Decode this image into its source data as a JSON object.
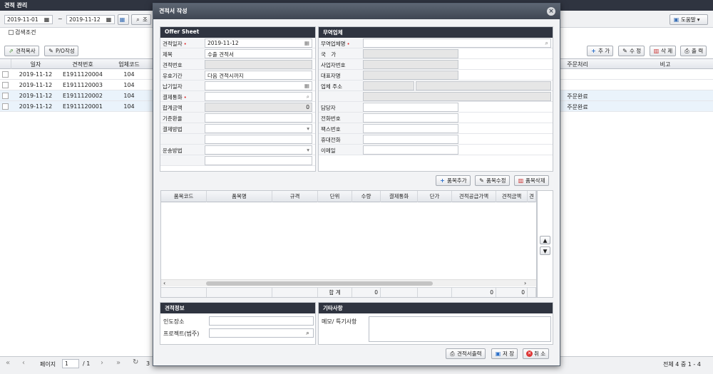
{
  "app": {
    "title": "견적 관리"
  },
  "filters": {
    "date_from": "2019-11-01",
    "date_sep": "~",
    "date_to": "2019-11-12",
    "query_label": "조",
    "search_cond": "검색조건",
    "help": "도움말"
  },
  "toolbar": {
    "copy": "견적복사",
    "po": "P/O작성",
    "add": "추 가",
    "edit": "수 정",
    "delete": "삭 제",
    "print": "출 력"
  },
  "grid": {
    "headers_left": [
      "일자",
      "견적번호",
      "업체코드"
    ],
    "headers_right": [
      "주문처리",
      "비고"
    ],
    "rows": [
      {
        "date": "2019-11-12",
        "no": "E1911120004",
        "code": "104",
        "status": ""
      },
      {
        "date": "2019-11-12",
        "no": "E1911120003",
        "code": "104",
        "status": ""
      },
      {
        "date": "2019-11-12",
        "no": "E1911120002",
        "code": "104",
        "status": "주문완료"
      },
      {
        "date": "2019-11-12",
        "no": "E1911120001",
        "code": "104",
        "status": "주문완료"
      }
    ]
  },
  "pager": {
    "page_label": "페이지",
    "page": "1",
    "total_pages": "/ 1",
    "count": "3",
    "summary": "전체 4 중 1 - 4"
  },
  "modal": {
    "title": "견적서 작성",
    "offer": {
      "heading": "Offer Sheet",
      "date_label": "견적일자",
      "date": "2019-11-12",
      "subject_label": "제목",
      "subject": "수출 견적서",
      "no_label": "견적번호",
      "no": "",
      "valid_label": "유효기간",
      "valid": "다음 견적시까지",
      "delivery_label": "납기일자",
      "delivery": "",
      "currency_label": "결제통화",
      "currency": "",
      "total_label": "합계금액",
      "total": "0",
      "rate_label": "기준환율",
      "rate": "",
      "payment_label": "결제방법",
      "payment": "",
      "shipping_label": "운송방법",
      "shipping": ""
    },
    "vendor": {
      "heading": "무역업체",
      "name_label": "무역업체명",
      "name": "",
      "country_label": "국　가",
      "country": "",
      "bizno_label": "사업자번호",
      "bizno": "",
      "ceo_label": "대표자명",
      "ceo": "",
      "address_label": "업체 주소",
      "contact_label": "담당자",
      "phone_label": "전화번호",
      "fax_label": "팩스번호",
      "mobile_label": "휴대전화",
      "email_label": "이메일"
    },
    "item_buttons": {
      "add": "품목추가",
      "edit": "품목수정",
      "delete": "품목삭제"
    },
    "items": {
      "headers": [
        "품목코드",
        "품목명",
        "규격",
        "단위",
        "수량",
        "결제통화",
        "단가",
        "견적공급가액",
        "견적금액",
        "견"
      ],
      "footer_label": "합 계",
      "footer_qty": "0",
      "footer_supply": "0",
      "footer_amount": "0"
    },
    "quote_info": {
      "heading": "견적정보",
      "place_label": "인도장소",
      "place": "",
      "project_label": "프로젝트(범주)",
      "project": ""
    },
    "other": {
      "heading": "기타사항",
      "memo_label": "메모/ 특기사항",
      "memo": ""
    },
    "footer": {
      "print": "견적서출력",
      "save": "저 장",
      "cancel": "취 소"
    }
  }
}
